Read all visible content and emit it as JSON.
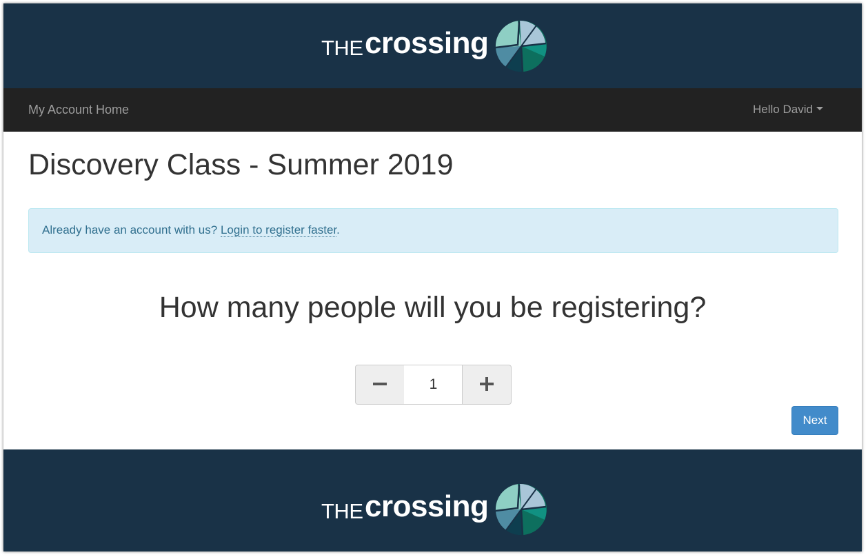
{
  "brand": {
    "logo_text_the": "THE",
    "logo_text_crossing": "crossing",
    "colors": {
      "header_bg": "#193247",
      "accent_light": "#8ecfc4",
      "accent_teal": "#119182",
      "accent_dark": "#0d6f5e",
      "accent_navy": "#1e4b5e"
    }
  },
  "nav": {
    "home_label": "My Account Home",
    "user_label": "Hello David",
    "user_icon": "caret-down-icon"
  },
  "page": {
    "title": "Discovery Class - Summer 2019"
  },
  "alert": {
    "text_before": "Already have an account with us? ",
    "link_text": "Login to register faster",
    "text_after": "."
  },
  "registration": {
    "question": "How many people will you be registering?",
    "count": "1",
    "decrement_icon": "minus-icon",
    "increment_icon": "plus-icon",
    "next_label": "Next"
  },
  "footer": {
    "logo_text_the": "THE",
    "logo_text_crossing": "crossing"
  }
}
